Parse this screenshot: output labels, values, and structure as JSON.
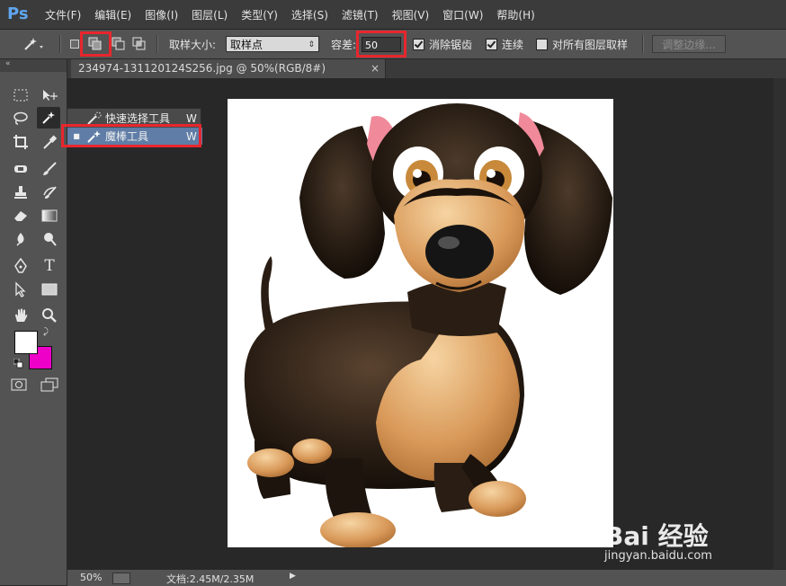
{
  "app": {
    "logo": "Ps"
  },
  "menu": [
    "文件(F)",
    "编辑(E)",
    "图像(I)",
    "图层(L)",
    "类型(Y)",
    "选择(S)",
    "滤镜(T)",
    "视图(V)",
    "窗口(W)",
    "帮助(H)"
  ],
  "options": {
    "sample_size_label": "取样大小:",
    "sample_size_value": "取样点",
    "tolerance_label": "容差:",
    "tolerance_value": "50",
    "antialias_label": "消除锯齿",
    "antialias_checked": true,
    "contiguous_label": "连续",
    "contiguous_checked": true,
    "sample_all_label": "对所有图层取样",
    "sample_all_checked": false,
    "refine_edge_label": "调整边缘..."
  },
  "document": {
    "tab_title": "234974-131120124S256.jpg @ 50%(RGB/8#)",
    "close_glyph": "×"
  },
  "flyout": {
    "items": [
      {
        "label": "快速选择工具",
        "shortcut": "W",
        "selected": false
      },
      {
        "label": "魔棒工具",
        "shortcut": "W",
        "selected": true
      }
    ]
  },
  "status": {
    "zoom": "50%",
    "doc_info": "文档:2.45M/2.35M"
  },
  "colors": {
    "foreground": "#ffffff",
    "background": "#ee00c8",
    "highlight": "#e8262d"
  },
  "watermark": {
    "brand": "Bai 经验",
    "url": "jingyan.baidu.com"
  },
  "icons": {
    "magic-wand": "magic-wand-icon",
    "marquee": "rect-marquee-icon",
    "move": "move-icon",
    "lasso": "lasso-icon",
    "crop": "crop-icon",
    "eyedropper": "eyedropper-icon",
    "brush": "brush-icon",
    "heal": "healing-icon",
    "stamp": "clone-stamp-icon",
    "history": "history-brush-icon",
    "eraser": "eraser-icon",
    "gradient": "gradient-icon",
    "blur": "blur-icon",
    "dodge": "dodge-icon",
    "pen": "pen-icon",
    "type": "type-icon",
    "path-select": "path-select-icon",
    "shape": "rectangle-shape-icon",
    "hand": "hand-icon",
    "zoom": "zoom-icon"
  }
}
